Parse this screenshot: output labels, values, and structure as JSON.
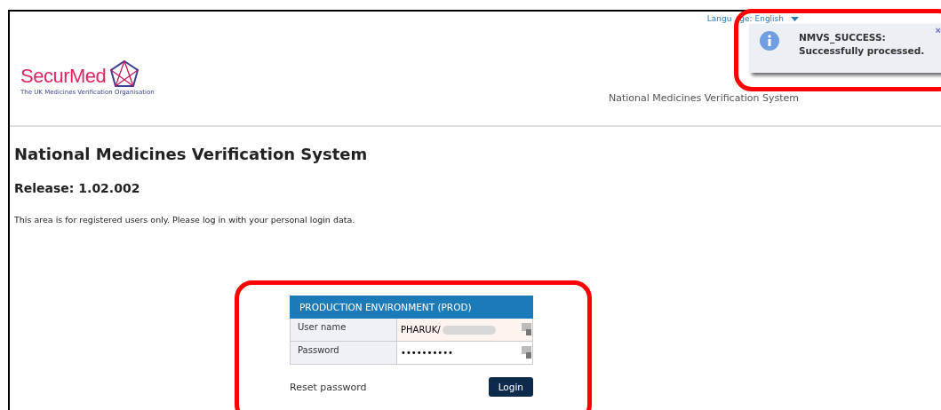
{
  "header": {
    "logo": {
      "name": "SecurMed",
      "tagline": "The UK Medicines Verification Organisation"
    },
    "language": {
      "label_start": "Langu",
      "label_end": "ge: English"
    },
    "system_title": "National Medicines Verification System"
  },
  "toast": {
    "title": "NMVS_SUCCESS:",
    "message": "Successfully processed.",
    "close": "×"
  },
  "main": {
    "title": "National Medicines Verification System",
    "release": "Release: 1.02.002",
    "intro": "This area is for registered users only. Please log in with your personal login data."
  },
  "login": {
    "environment": "PRODUCTION ENVIRONMENT (PROD)",
    "fields": [
      {
        "label": "User name",
        "value": "PHARUK/",
        "masked": true,
        "filled": true
      },
      {
        "label": "Password",
        "value": "••••••••••",
        "masked": false,
        "filled": false
      }
    ],
    "reset_link": "Reset password",
    "button": "Login"
  }
}
